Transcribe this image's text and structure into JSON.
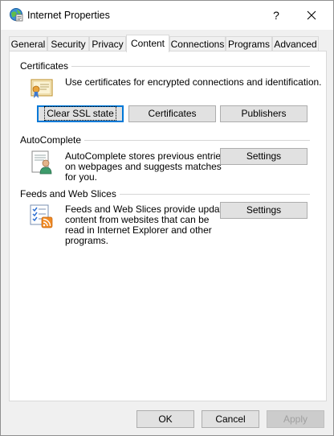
{
  "window": {
    "title": "Internet Properties"
  },
  "titlebar": {
    "help": "?",
    "close": "✕"
  },
  "tabs": [
    {
      "label": "General"
    },
    {
      "label": "Security"
    },
    {
      "label": "Privacy"
    },
    {
      "label": "Content",
      "active": true
    },
    {
      "label": "Connections"
    },
    {
      "label": "Programs"
    },
    {
      "label": "Advanced"
    }
  ],
  "certificates": {
    "heading": "Certificates",
    "description": "Use certificates for encrypted connections and identification.",
    "buttons": {
      "clear_ssl": "Clear SSL state",
      "certificates": "Certificates",
      "publishers": "Publishers"
    }
  },
  "autocomplete": {
    "heading": "AutoComplete",
    "description_lines": [
      "AutoComplete stores previous entries",
      "on webpages and suggests matches",
      "for you."
    ],
    "settings": "Settings"
  },
  "feeds": {
    "heading": "Feeds and Web Slices",
    "description_lines": [
      "Feeds and Web Slices provide updated",
      "content from websites that can be",
      "read in Internet Explorer and other",
      "programs."
    ],
    "settings": "Settings"
  },
  "footer": {
    "ok": "OK",
    "cancel": "Cancel",
    "apply": "Apply"
  },
  "colors": {
    "focus_blue": "#0078d7",
    "panel": "#ffffff",
    "window": "#f0f0f0"
  }
}
